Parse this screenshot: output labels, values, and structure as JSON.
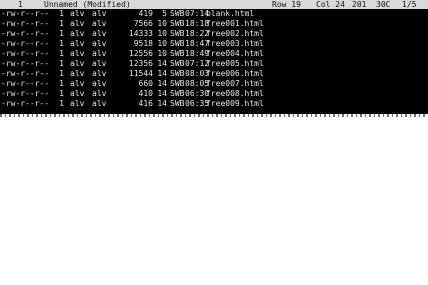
{
  "status": {
    "window_number": "1",
    "buffer_name": "Unnamed (Modified)",
    "row": "Row 19",
    "col": "Col 24",
    "char": "201",
    "hex": "30C",
    "level": "1/5"
  },
  "listing": {
    "rows": [
      {
        "perm": "-rw-r--r--",
        "links": "1",
        "owner": "alv",
        "group": "alv",
        "size": "419",
        "month": "5",
        "day": "SWB",
        "time": "07:14",
        "name": "blank.html"
      },
      {
        "perm": "-rw-r--r--",
        "links": "1",
        "owner": "alv",
        "group": "alv",
        "size": "7566",
        "month": "10",
        "day": "SWB",
        "time": "18:18",
        "name": "free001.html"
      },
      {
        "perm": "-rw-r--r--",
        "links": "1",
        "owner": "alv",
        "group": "alv",
        "size": "14333",
        "month": "10",
        "day": "SWB",
        "time": "18:22",
        "name": "free002.html"
      },
      {
        "perm": "-rw-r--r--",
        "links": "1",
        "owner": "alv",
        "group": "alv",
        "size": "9518",
        "month": "10",
        "day": "SWB",
        "time": "18:47",
        "name": "free003.html"
      },
      {
        "perm": "-rw-r--r--",
        "links": "1",
        "owner": "alv",
        "group": "alv",
        "size": "12556",
        "month": "10",
        "day": "SWB",
        "time": "18:49",
        "name": "free004.html"
      },
      {
        "perm": "-rw-r--r--",
        "links": "1",
        "owner": "alv",
        "group": "alv",
        "size": "12356",
        "month": "14",
        "day": "SWB",
        "time": "07:12",
        "name": "free005.html"
      },
      {
        "perm": "-rw-r--r--",
        "links": "1",
        "owner": "alv",
        "group": "alv",
        "size": "11544",
        "month": "14",
        "day": "SWB",
        "time": "08:03",
        "name": "free006.html"
      },
      {
        "perm": "-rw-r--r--",
        "links": "1",
        "owner": "alv",
        "group": "alv",
        "size": "660",
        "month": "14",
        "day": "SWB",
        "time": "08:05",
        "name": "free007.html"
      },
      {
        "perm": "-rw-r--r--",
        "links": "1",
        "owner": "alv",
        "group": "alv",
        "size": "410",
        "month": "14",
        "day": "SWB",
        "time": "06:30",
        "name": "free008.html"
      },
      {
        "perm": "-rw-r--r--",
        "links": "1",
        "owner": "alv",
        "group": "alv",
        "size": "416",
        "month": "14",
        "day": "SWB",
        "time": "06:35",
        "name": "free009.html"
      }
    ]
  }
}
